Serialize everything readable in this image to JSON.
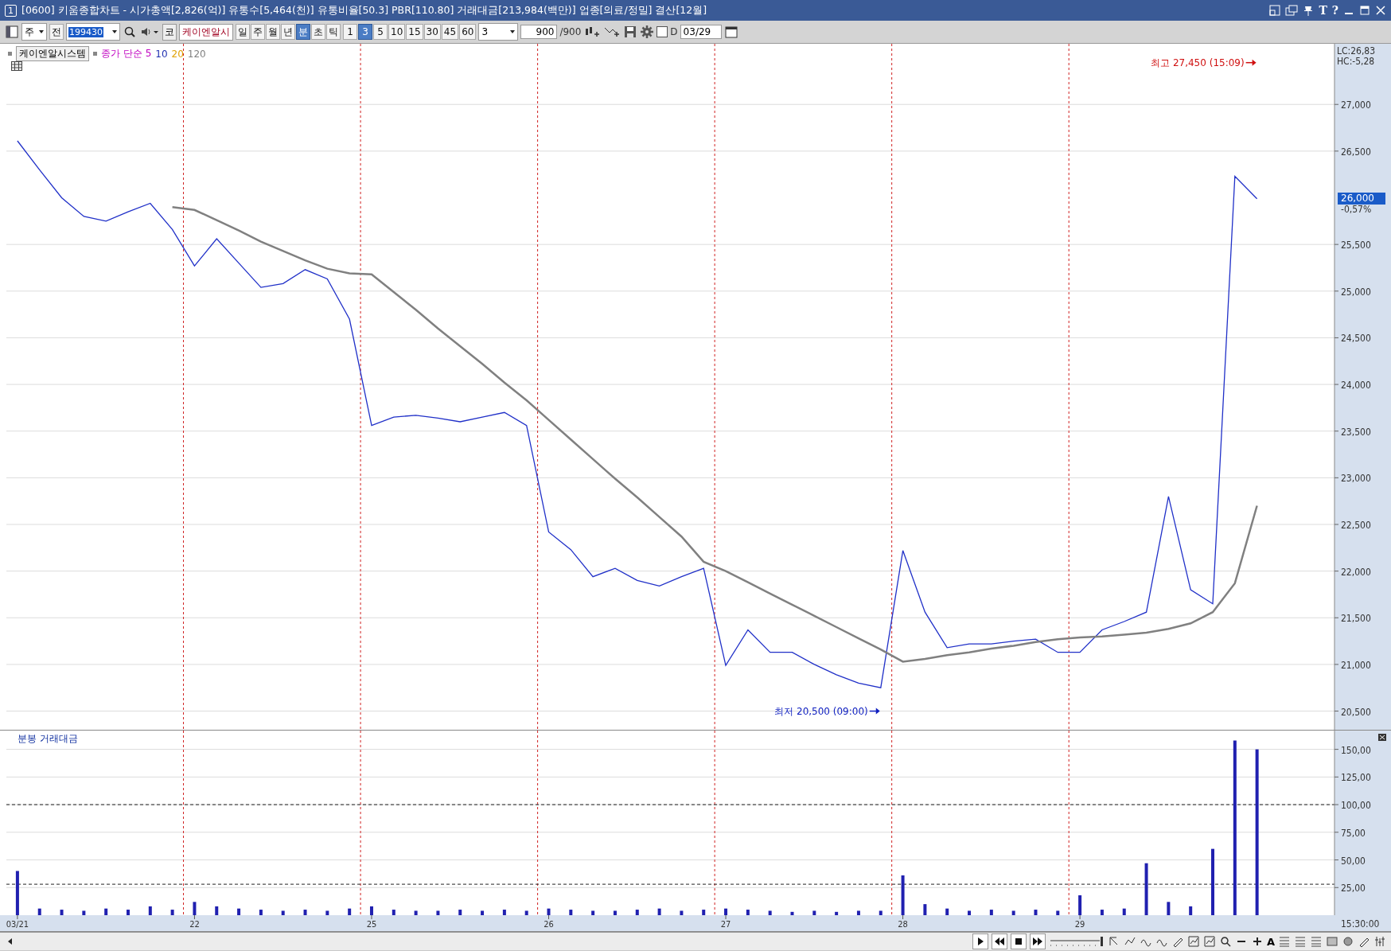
{
  "window": {
    "badge": "1",
    "title": "[0600] 키움종합차트 - 시가총액[2,826(억)] 유통수[5,464(천)] 유통비율[50.3] PBR[110.80] 거래대금[213,984(백만)] 업종[의료/정밀] 결산[12월]",
    "title_buttons": [
      "T",
      "?"
    ]
  },
  "toolbar": {
    "market": "주",
    "scope": "전",
    "code": "199430",
    "name_tag": "코",
    "name": "케이엔알시",
    "periods": [
      {
        "label": "일",
        "selected": false
      },
      {
        "label": "주",
        "selected": false
      },
      {
        "label": "월",
        "selected": false
      },
      {
        "label": "년",
        "selected": false
      },
      {
        "label": "분",
        "selected": true
      },
      {
        "label": "초",
        "selected": false
      },
      {
        "label": "틱",
        "selected": false
      }
    ],
    "intervals": [
      {
        "label": "1",
        "selected": false
      },
      {
        "label": "3",
        "selected": true
      },
      {
        "label": "5",
        "selected": false
      },
      {
        "label": "10",
        "selected": false
      },
      {
        "label": "15",
        "selected": false
      },
      {
        "label": "30",
        "selected": false
      },
      {
        "label": "45",
        "selected": false
      },
      {
        "label": "60",
        "selected": false
      }
    ],
    "count_combo": "3",
    "count": "900",
    "count_max": "/900",
    "d_checkbox": {
      "label": "D",
      "checked": false
    },
    "date": "03/29"
  },
  "price_pane": {
    "stock": "케이엔알시스템",
    "legend": [
      {
        "text": "종가 단순 5",
        "color": "#c000c0"
      },
      {
        "text": "10",
        "color": "#2030b0"
      },
      {
        "text": "20",
        "color": "#e0a000"
      },
      {
        "text": "120",
        "color": "#808080"
      }
    ],
    "lc": "LC:26,83",
    "hc": "HC:-5,28",
    "current_price": "26,000",
    "change": "-0,57%",
    "chart_data": {
      "type": "line",
      "categories": [
        null,
        null,
        null,
        null,
        null,
        null,
        null,
        null,
        null,
        null,
        null,
        null,
        null,
        null,
        null,
        null,
        null,
        null,
        null,
        null,
        null,
        null,
        null,
        null,
        null,
        null,
        null,
        null,
        null,
        null,
        null,
        null,
        null,
        null,
        null,
        null,
        null,
        null,
        null,
        null,
        null,
        null,
        null,
        null,
        null,
        null,
        null,
        null,
        null,
        null,
        null,
        null,
        null,
        null,
        null,
        null,
        null,
        null,
        null,
        null
      ],
      "series": [
        {
          "color": "#2030c8",
          "values": [
            26610,
            26300,
            26000,
            25800,
            25750,
            25850,
            25940,
            25660,
            25270,
            25560,
            25300,
            25040,
            25080,
            25230,
            25130,
            24700,
            23560,
            23650,
            23670,
            23640,
            23600,
            23650,
            23700,
            23560,
            22420,
            22230,
            21940,
            22030,
            21900,
            21840,
            21940,
            22030,
            20990,
            21370,
            21130,
            21130,
            21000,
            20890,
            20800,
            20750,
            22220,
            21560,
            21180,
            21220,
            21220,
            21250,
            21270,
            21130,
            21130,
            21370,
            21460,
            21560,
            22800,
            21800,
            21650,
            26230,
            25990,
            null,
            null,
            null
          ]
        },
        {
          "color": "#808080",
          "values": [
            null,
            null,
            null,
            null,
            null,
            null,
            null,
            25900,
            25870,
            25760,
            25650,
            25530,
            25430,
            25330,
            25240,
            25190,
            25180,
            24990,
            24800,
            24600,
            24410,
            24220,
            24020,
            23830,
            23620,
            23410,
            23200,
            22990,
            22790,
            22580,
            22370,
            22100,
            22000,
            21880,
            21760,
            21640,
            21520,
            21400,
            21280,
            21160,
            21030,
            21060,
            21100,
            21130,
            21170,
            21200,
            21240,
            21270,
            21290,
            21300,
            21320,
            21340,
            21380,
            21440,
            21560,
            21870,
            22700,
            null,
            null,
            null
          ]
        }
      ],
      "ylim": [
        20300,
        27650
      ],
      "yticks": [
        {
          "value": 20500,
          "label": "20,500"
        },
        {
          "value": 21000,
          "label": "21,000"
        },
        {
          "value": 21500,
          "label": "21,500"
        },
        {
          "value": 22000,
          "label": "22,000"
        },
        {
          "value": 22500,
          "label": "22,500"
        },
        {
          "value": 23000,
          "label": "23,000"
        },
        {
          "value": 23500,
          "label": "23,500"
        },
        {
          "value": 24000,
          "label": "24,000"
        },
        {
          "value": 24500,
          "label": "24,500"
        },
        {
          "value": 25000,
          "label": "25,000"
        },
        {
          "value": 25500,
          "label": "25,500"
        },
        {
          "value": 26500,
          "label": "26,500"
        },
        {
          "value": 27000,
          "label": "27,000"
        }
      ],
      "grid": true,
      "annotations": [
        "최고 27,450 (15:09)",
        "최저 20,500 (09:00)"
      ]
    }
  },
  "volume_pane": {
    "title": "분봉 거래대금",
    "chart_data": {
      "type": "bar",
      "categories": [
        "03/21",
        null,
        null,
        null,
        null,
        null,
        null,
        null,
        "22",
        null,
        null,
        null,
        null,
        null,
        null,
        null,
        "25",
        null,
        null,
        null,
        null,
        null,
        null,
        null,
        "26",
        null,
        null,
        null,
        null,
        null,
        null,
        null,
        "27",
        null,
        null,
        null,
        null,
        null,
        null,
        null,
        "28",
        null,
        null,
        null,
        null,
        null,
        null,
        null,
        "29",
        null,
        null,
        null,
        null,
        null,
        null,
        null,
        null,
        null,
        null,
        null
      ],
      "series": [
        {
          "color": "#2020b0",
          "values": [
            40,
            6,
            5,
            4,
            6,
            5,
            8,
            5,
            12,
            8,
            6,
            5,
            4,
            5,
            4,
            6,
            8,
            5,
            4,
            4,
            5,
            4,
            5,
            4,
            6,
            5,
            4,
            4,
            5,
            6,
            4,
            5,
            6,
            5,
            4,
            3,
            4,
            3,
            4,
            4,
            36,
            10,
            6,
            4,
            5,
            4,
            5,
            4,
            18,
            5,
            6,
            47,
            12,
            8,
            60,
            158,
            150,
            null,
            null,
            null
          ]
        }
      ],
      "ylim": [
        0,
        167
      ],
      "yticks": [
        {
          "value": 25,
          "label": "25,00"
        },
        {
          "value": 50,
          "label": "50,00"
        },
        {
          "value": 75,
          "label": "75,00"
        },
        {
          "value": 100,
          "label": "100,00"
        },
        {
          "value": 125,
          "label": "125,00"
        },
        {
          "value": 150,
          "label": "150,00"
        }
      ],
      "grid": true,
      "ref_lines": [
        {
          "axis": "y",
          "value": 100
        },
        {
          "axis": "y",
          "value": 28
        }
      ]
    }
  },
  "x_axis": {
    "time": "15:30:00"
  },
  "bottom_bar": {
    "speed_slider": {
      "level": 1
    },
    "font_button": "A"
  }
}
